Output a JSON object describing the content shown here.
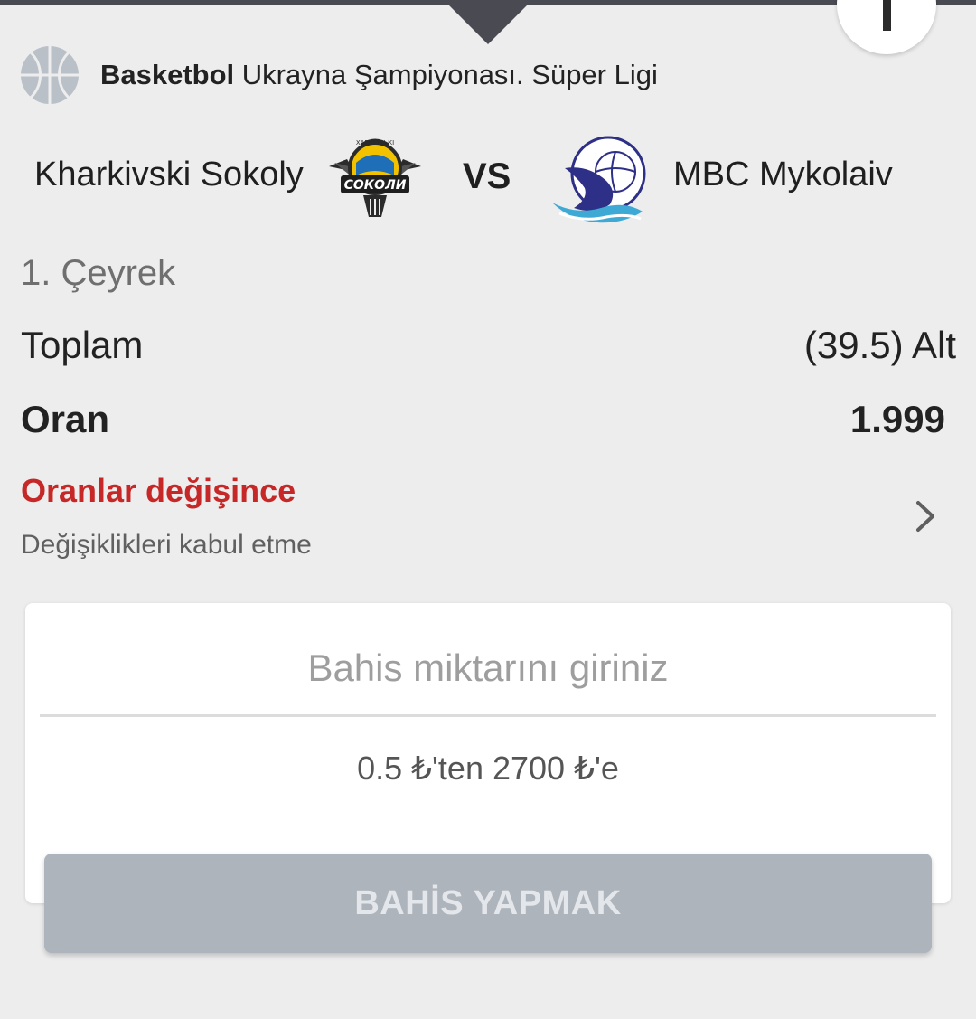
{
  "header": {
    "sport": "Basketbol",
    "league": "Ukrayna Şampiyonası. Süper Ligi",
    "sport_icon": "basketball-icon"
  },
  "match": {
    "home_team": "Kharkivski Sokoly",
    "vs_label": "VS",
    "away_team": "MBC Mykolaiv",
    "home_logo_text": "СОКОЛИ",
    "home_logo_caption": "ХАРКІВСЬКІ"
  },
  "bet": {
    "period": "1. Çeyrek",
    "market_label": "Toplam",
    "market_value": "(39.5) Alt",
    "odds_label": "Oran",
    "odds_value": "1.999"
  },
  "odds_change": {
    "title": "Oranlar değişince",
    "setting": "Değişiklikleri kabul etme",
    "icon": "chevron-right-icon"
  },
  "stake": {
    "placeholder": "Bahis miktarını giriniz",
    "value": "",
    "range": "0.5 ₺'ten 2700 ₺'e"
  },
  "actions": {
    "place_bet_label": "BAHİS YAPMAK"
  },
  "colors": {
    "background": "#ededed",
    "accent_red": "#c62828",
    "top_bar": "#4a4a52",
    "button_disabled": "#aeb4bb"
  }
}
